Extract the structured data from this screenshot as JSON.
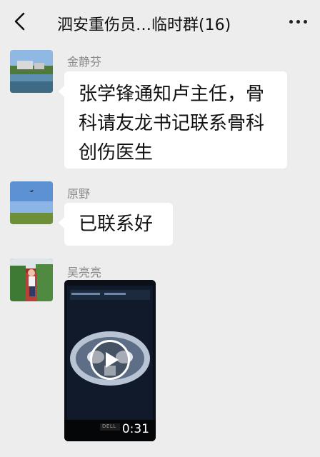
{
  "header": {
    "title": "泗安重伤员…临时群(16)"
  },
  "messages": [
    {
      "sender": "金静芬",
      "text_lines": [
        "张学锋通知卢主任，骨",
        "科请友龙书记联系骨科",
        "创伤医生"
      ]
    },
    {
      "sender": "原野",
      "text_lines": [
        "已联系好"
      ]
    },
    {
      "sender": "吴亮亮",
      "video": {
        "duration": "0:31",
        "monitor_brand": "DELL"
      }
    }
  ],
  "colors": {
    "background": "#ededed",
    "bubble": "#ffffff",
    "sender_name": "#8a8a8a"
  },
  "icons": {
    "back": "chevron-left-icon",
    "more": "more-dots-icon",
    "play": "play-icon"
  }
}
